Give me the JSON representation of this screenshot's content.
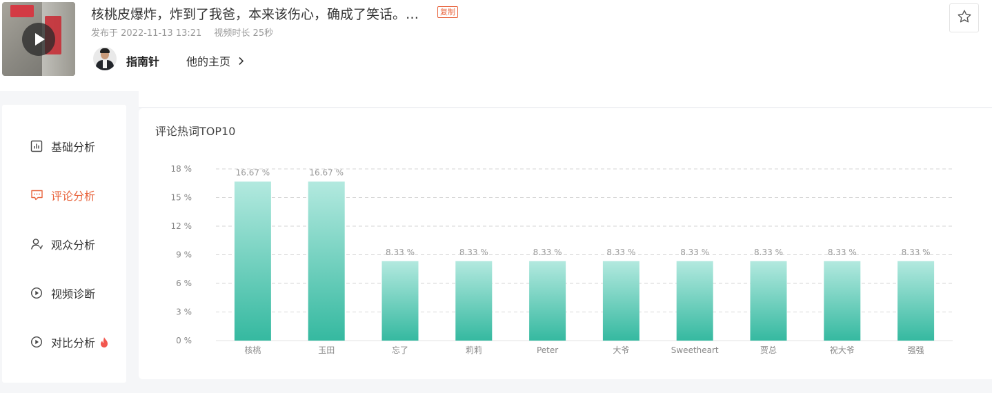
{
  "header": {
    "title": "核桃皮爆炸，炸到了我爸，本来该伤心，确成了笑话。…",
    "copy_label": "复制",
    "publish_time": "发布于 2022-11-13 13:21",
    "duration": "视频时长 25秒",
    "author_name": "指南针",
    "home_link": "他的主页",
    "star_icon": "star-outline-icon"
  },
  "sidebar": {
    "items": [
      {
        "label": "基础分析",
        "icon": "bar-chart-icon",
        "active": false
      },
      {
        "label": "评论分析",
        "icon": "comment-icon",
        "active": true
      },
      {
        "label": "观众分析",
        "icon": "user-icon",
        "active": false
      },
      {
        "label": "视频诊断",
        "icon": "play-circle-icon",
        "active": false
      },
      {
        "label": "对比分析",
        "icon": "play-circle-icon",
        "active": false,
        "badge_icon": "flame-icon"
      }
    ]
  },
  "colors": {
    "accent": "#e8643d",
    "bar_top": "#b3e9df",
    "bar_bottom": "#35b9a0"
  },
  "chart_data": {
    "type": "bar",
    "title": "评论热词TOP10",
    "categories": [
      "核桃",
      "玉田",
      "忘了",
      "莉莉",
      "Peter",
      "大爷",
      "Sweetheart",
      "贾总",
      "祝大爷",
      "强强"
    ],
    "values": [
      16.67,
      16.67,
      8.33,
      8.33,
      8.33,
      8.33,
      8.33,
      8.33,
      8.33,
      8.33
    ],
    "value_labels": [
      "16.67 %",
      "16.67 %",
      "8.33 %",
      "8.33 %",
      "8.33 %",
      "8.33 %",
      "8.33 %",
      "8.33 %",
      "8.33 %",
      "8.33 %"
    ],
    "yticks": [
      "0 %",
      "3 %",
      "6 %",
      "9 %",
      "12 %",
      "15 %",
      "18 %"
    ],
    "ylim": [
      0,
      18
    ],
    "grid": true,
    "legend": "none"
  }
}
